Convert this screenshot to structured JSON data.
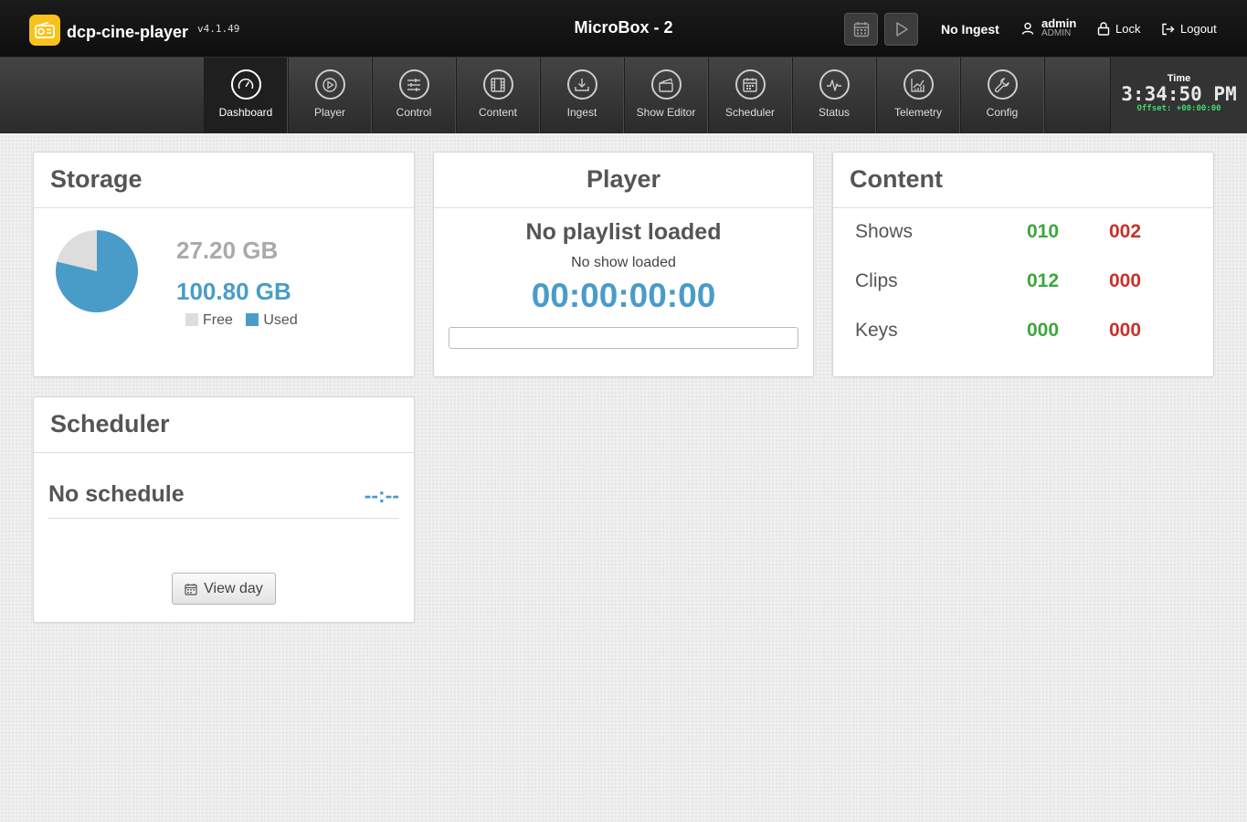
{
  "app": {
    "brand": "dcp-cine-player",
    "version": "v4.1.49",
    "device": "MicroBox - 2",
    "ingest_status": "No Ingest",
    "user": {
      "name": "admin",
      "role": "ADMIN"
    },
    "lock_label": "Lock",
    "logout_label": "Logout"
  },
  "nav": {
    "items": [
      {
        "label": "Dashboard",
        "icon": "dashboard-gauge-icon",
        "active": true
      },
      {
        "label": "Player",
        "icon": "play-circle-icon",
        "active": false
      },
      {
        "label": "Control",
        "icon": "sliders-icon",
        "active": false
      },
      {
        "label": "Content",
        "icon": "film-icon",
        "active": false
      },
      {
        "label": "Ingest",
        "icon": "download-icon",
        "active": false
      },
      {
        "label": "Show Editor",
        "icon": "clapperboard-icon",
        "active": false
      },
      {
        "label": "Scheduler",
        "icon": "calendar-icon",
        "active": false
      },
      {
        "label": "Status",
        "icon": "pulse-icon",
        "active": false
      },
      {
        "label": "Telemetry",
        "icon": "chart-icon",
        "active": false
      },
      {
        "label": "Config",
        "icon": "wrench-icon",
        "active": false
      }
    ]
  },
  "clock": {
    "label": "Time",
    "value": "3:34:50 PM",
    "offset": "Offset: +00:00:00"
  },
  "storage": {
    "title": "Storage",
    "free": "27.20 GB",
    "used": "100.80 GB",
    "used_fraction": 0.7875,
    "legend_free": "Free",
    "legend_used": "Used",
    "colors": {
      "free": "#dddddd",
      "used": "#4a9cc8"
    }
  },
  "player": {
    "title": "Player",
    "playlist": "No playlist loaded",
    "show": "No show loaded",
    "timecode": "00:00:00:00",
    "progress": 0
  },
  "content": {
    "title": "Content",
    "rows": [
      {
        "label": "Shows",
        "ok": "010",
        "bad": "002"
      },
      {
        "label": "Clips",
        "ok": "012",
        "bad": "000"
      },
      {
        "label": "Keys",
        "ok": "000",
        "bad": "000"
      }
    ]
  },
  "scheduler": {
    "title": "Scheduler",
    "status": "No schedule",
    "time": "--:--",
    "view_day_label": "View day"
  },
  "colors": {
    "accent": "#4a9cc8",
    "green": "#3ea53e",
    "red": "#c9302c",
    "logo": "#f7c21c"
  }
}
